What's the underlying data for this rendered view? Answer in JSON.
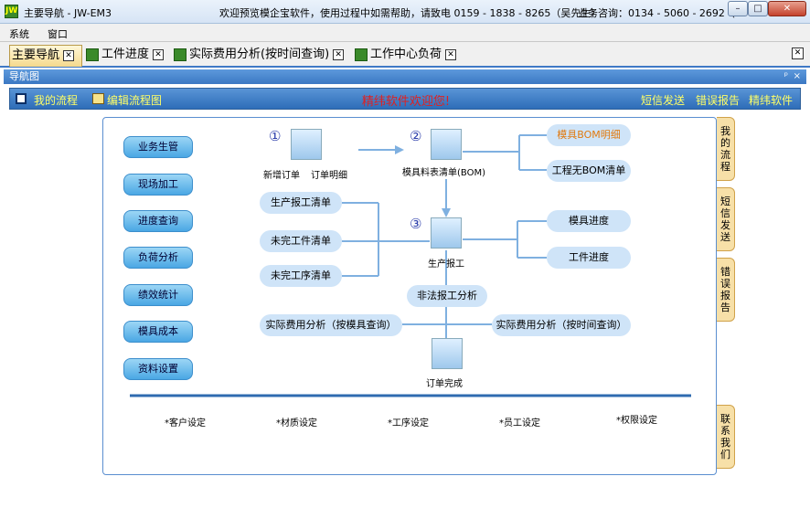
{
  "window": {
    "title": "主要导航 - JW-EM3",
    "welcome": "欢迎预览模企宝软件，使用过程中如需帮助，请致电 0159 - 1838 - 8265（吴先生）",
    "hotline": "业务咨询：0134 - 5060 - 2692（"
  },
  "menu": [
    "系统",
    "窗口"
  ],
  "tabs": [
    "主要导航",
    "工件进度",
    "实际费用分析(按时间查询)",
    "工作中心负荷"
  ],
  "panel": {
    "title": "导航图",
    "pin": "ᵖ",
    "close": "×"
  },
  "toolbar": {
    "my_flow": "我的流程",
    "edit_flow": "编辑流程图",
    "welcome": "精纬软件欢迎您!",
    "sms": "短信发送",
    "error": "错误报告",
    "brand": "精纬软件"
  },
  "left_buttons": [
    "业务生管",
    "现场加工",
    "进度查询",
    "负荷分析",
    "绩效统计",
    "模具成本",
    "资料设置"
  ],
  "flow": {
    "step_nums": [
      "①",
      "②",
      "③"
    ],
    "new_order": "新增订单",
    "order_detail": "订单明细",
    "bom": "模具料表清单(BOM)",
    "bom_detail": "模具BOM明细",
    "no_bom": "工程无BOM清单",
    "prod_report_list": "生产报工清单",
    "unfinished_parts": "未完工件清单",
    "unfinished_proc": "未完工序清单",
    "prod_report": "生产报工",
    "mold_progress": "模具进度",
    "part_progress": "工件进度",
    "illegal": "非法报工分析",
    "cost_mold": "实际费用分析（按模具查询）",
    "cost_time": "实际费用分析（按时间查询）",
    "order_done": "订单完成"
  },
  "settings": [
    "*客户设定",
    "*材质设定",
    "*工序设定",
    "*员工设定",
    "*权限设定"
  ],
  "side_tabs": [
    "我的流程",
    "短信发送",
    "错误报告",
    "联系我们"
  ]
}
